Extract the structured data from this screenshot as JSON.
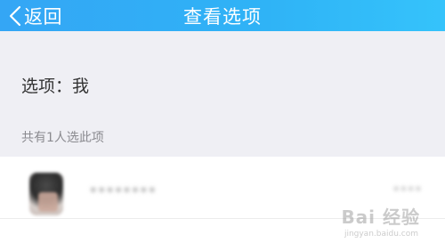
{
  "navbar": {
    "back_label": "返回",
    "title": "查看选项",
    "color": "#2fb3f6"
  },
  "option": {
    "text": "选项：我"
  },
  "voters": {
    "count_text": "共有1人选此项",
    "items": [
      {
        "name": "••••••••",
        "time": "••••"
      }
    ]
  },
  "watermark": {
    "text": "Bai 经验",
    "sub": "jingyan.baidu.com"
  }
}
